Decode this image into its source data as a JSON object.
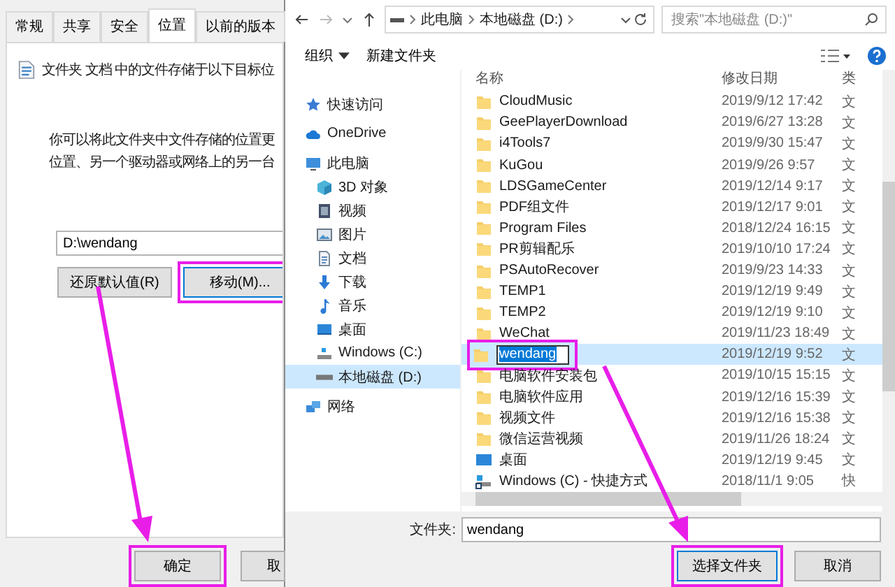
{
  "properties_dialog": {
    "tabs": [
      {
        "label": "常规",
        "selected": false
      },
      {
        "label": "共享",
        "selected": false
      },
      {
        "label": "安全",
        "selected": false
      },
      {
        "label": "位置",
        "selected": true
      },
      {
        "label": "以前的版本",
        "selected": false
      }
    ],
    "location_text": "文件夹 文档 中的文件存储于以下目标位",
    "description_lines": [
      "你可以将此文件夹中文件存储的位置更",
      "位置、另一个驱动器或网络上的另一台"
    ],
    "path_value": "D:\\wendang",
    "buttons": [
      {
        "label": "还原默认值(R)",
        "highlighted": false
      },
      {
        "label": "移动(M)...",
        "highlighted": true
      }
    ],
    "footer_buttons": [
      {
        "label": "确定",
        "highlighted": true
      },
      {
        "label": "取",
        "highlighted": false
      }
    ]
  },
  "folder_dialog": {
    "breadcrumb": [
      "此电脑",
      "本地磁盘 (D:)"
    ],
    "search": {
      "placeholder": "搜索\"本地磁盘 (D:)\""
    },
    "toolbar": [
      {
        "label": "组织",
        "kind": "menu"
      },
      {
        "label": "新建文件夹",
        "kind": "button"
      }
    ],
    "nav": [
      {
        "label": "快速访问",
        "kind": "star",
        "selected": false
      },
      {
        "label": "OneDrive",
        "kind": "cloud",
        "selected": false
      },
      {
        "label": "此电脑",
        "kind": "pc",
        "selected": false,
        "children": [
          {
            "label": "3D 对象",
            "kind": "cube",
            "selected": false
          },
          {
            "label": "视频",
            "kind": "video",
            "selected": false
          },
          {
            "label": "图片",
            "kind": "picture",
            "selected": false
          },
          {
            "label": "文档",
            "kind": "doc",
            "selected": false
          },
          {
            "label": "下载",
            "kind": "download",
            "selected": false
          },
          {
            "label": "音乐",
            "kind": "music",
            "selected": false
          },
          {
            "label": "桌面",
            "kind": "desktop",
            "selected": false
          },
          {
            "label": "Windows (C:)",
            "kind": "drive-c",
            "selected": false
          },
          {
            "label": "本地磁盘 (D:)",
            "kind": "drive",
            "selected": true
          }
        ]
      },
      {
        "label": "网络",
        "kind": "network",
        "selected": false
      }
    ],
    "columns": [
      "名称",
      "修改日期",
      "类"
    ],
    "rows": [
      {
        "name": "CloudMusic",
        "date": "2019/9/12 17:42",
        "type": "文",
        "kind": "folder",
        "selected": false,
        "editing": false,
        "highlighted": false
      },
      {
        "name": "GeePlayerDownload",
        "date": "2019/6/27 13:28",
        "type": "文",
        "kind": "folder",
        "selected": false,
        "editing": false,
        "highlighted": false
      },
      {
        "name": "i4Tools7",
        "date": "2019/9/30 15:47",
        "type": "文",
        "kind": "folder",
        "selected": false,
        "editing": false,
        "highlighted": false
      },
      {
        "name": "KuGou",
        "date": "2019/9/26 9:57",
        "type": "文",
        "kind": "folder",
        "selected": false,
        "editing": false,
        "highlighted": false
      },
      {
        "name": "LDSGameCenter",
        "date": "2019/12/14 9:17",
        "type": "文",
        "kind": "folder",
        "selected": false,
        "editing": false,
        "highlighted": false
      },
      {
        "name": "PDF组文件",
        "date": "2019/12/17 9:01",
        "type": "文",
        "kind": "folder",
        "selected": false,
        "editing": false,
        "highlighted": false
      },
      {
        "name": "Program Files",
        "date": "2018/12/24 16:15",
        "type": "文",
        "kind": "folder",
        "selected": false,
        "editing": false,
        "highlighted": false
      },
      {
        "name": "PR剪辑配乐",
        "date": "2019/10/10 17:24",
        "type": "文",
        "kind": "folder",
        "selected": false,
        "editing": false,
        "highlighted": false
      },
      {
        "name": "PSAutoRecover",
        "date": "2019/9/23 14:33",
        "type": "文",
        "kind": "folder",
        "selected": false,
        "editing": false,
        "highlighted": false
      },
      {
        "name": "TEMP1",
        "date": "2019/12/19 9:49",
        "type": "文",
        "kind": "folder",
        "selected": false,
        "editing": false,
        "highlighted": false
      },
      {
        "name": "TEMP2",
        "date": "2019/12/19 9:10",
        "type": "文",
        "kind": "folder",
        "selected": false,
        "editing": false,
        "highlighted": false
      },
      {
        "name": "WeChat",
        "date": "2019/11/23 18:49",
        "type": "文",
        "kind": "folder",
        "selected": false,
        "editing": false,
        "highlighted": false
      },
      {
        "name": "wendang",
        "date": "2019/12/19 9:52",
        "type": "文",
        "kind": "folder",
        "selected": true,
        "editing": true,
        "highlighted": true
      },
      {
        "name": "电脑软件安装包",
        "date": "2019/10/15 15:15",
        "type": "文",
        "kind": "folder",
        "selected": false,
        "editing": false,
        "highlighted": false
      },
      {
        "name": "电脑软件应用",
        "date": "2019/12/16 15:39",
        "type": "文",
        "kind": "folder",
        "selected": false,
        "editing": false,
        "highlighted": false
      },
      {
        "name": "视频文件",
        "date": "2019/12/16 15:38",
        "type": "文",
        "kind": "folder",
        "selected": false,
        "editing": false,
        "highlighted": false
      },
      {
        "name": "微信运营视频",
        "date": "2019/11/26 18:24",
        "type": "文",
        "kind": "folder",
        "selected": false,
        "editing": false,
        "highlighted": false
      },
      {
        "name": "桌面",
        "date": "2019/12/19 9:45",
        "type": "文",
        "kind": "desktop",
        "selected": false,
        "editing": false,
        "highlighted": false
      },
      {
        "name": "Windows (C) - 快捷方式",
        "date": "2018/11/1 9:05",
        "type": "快",
        "kind": "shortcut",
        "selected": false,
        "editing": false,
        "highlighted": false
      }
    ],
    "footer": {
      "label": "文件夹:",
      "value": "wendang",
      "buttons": [
        {
          "label": "选择文件夹",
          "highlighted": true,
          "default": true
        },
        {
          "label": "取消",
          "highlighted": false,
          "default": false
        }
      ]
    }
  }
}
